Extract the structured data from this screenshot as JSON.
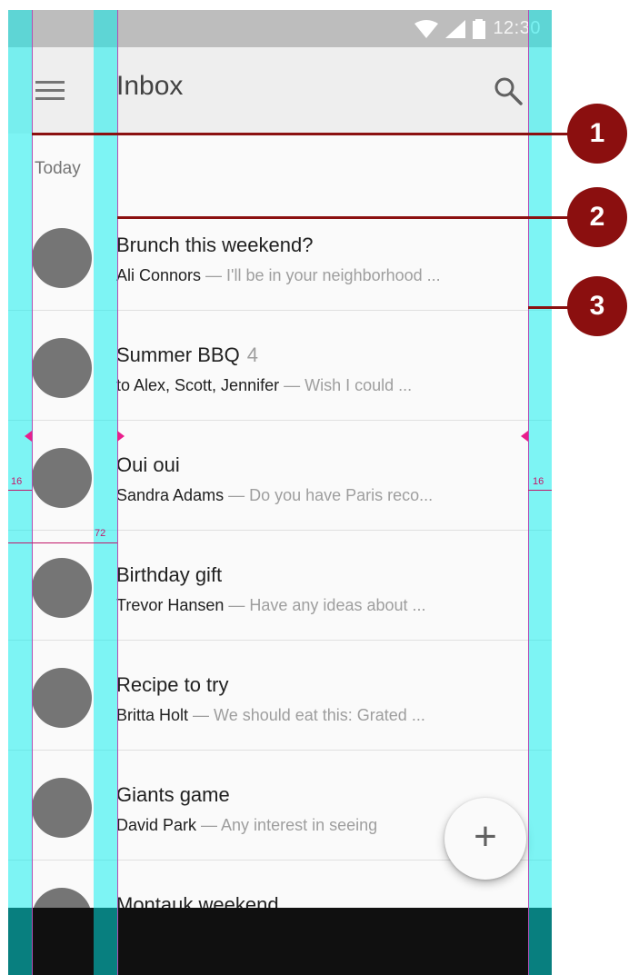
{
  "status_bar": {
    "time": "12:30"
  },
  "app_bar": {
    "title": "Inbox"
  },
  "list": {
    "subheader": "Today",
    "items": [
      {
        "title": "Brunch this weekend?",
        "count": "",
        "sender": "Ali Connors",
        "preview": " — I'll be in your neighborhood ..."
      },
      {
        "title": "Summer BBQ",
        "count": "4",
        "sender": "to Alex, Scott, Jennifer",
        "preview": " — Wish I could ..."
      },
      {
        "title": "Oui oui",
        "count": "",
        "sender": "Sandra Adams",
        "preview": " — Do you have Paris reco..."
      },
      {
        "title": "Birthday gift",
        "count": "",
        "sender": "Trevor Hansen",
        "preview": " — Have any ideas about ..."
      },
      {
        "title": "Recipe to try",
        "count": "",
        "sender": "Britta Holt",
        "preview": " — We should eat this: Grated ..."
      },
      {
        "title": "Giants game",
        "count": "",
        "sender": "David Park",
        "preview": " — Any interest in seeing"
      },
      {
        "title": "Montauk weekend",
        "count": "",
        "sender": "",
        "preview": ""
      }
    ]
  },
  "fab": {
    "icon": "add-icon",
    "label": "+"
  },
  "spec": {
    "left_margin": "16",
    "text_keyline": "72",
    "right_margin": "16"
  },
  "callouts": [
    "1",
    "2",
    "3"
  ],
  "colors": {
    "keyline": "#00eeee",
    "callout": "#8b0f0f",
    "avatar": "#757575"
  }
}
